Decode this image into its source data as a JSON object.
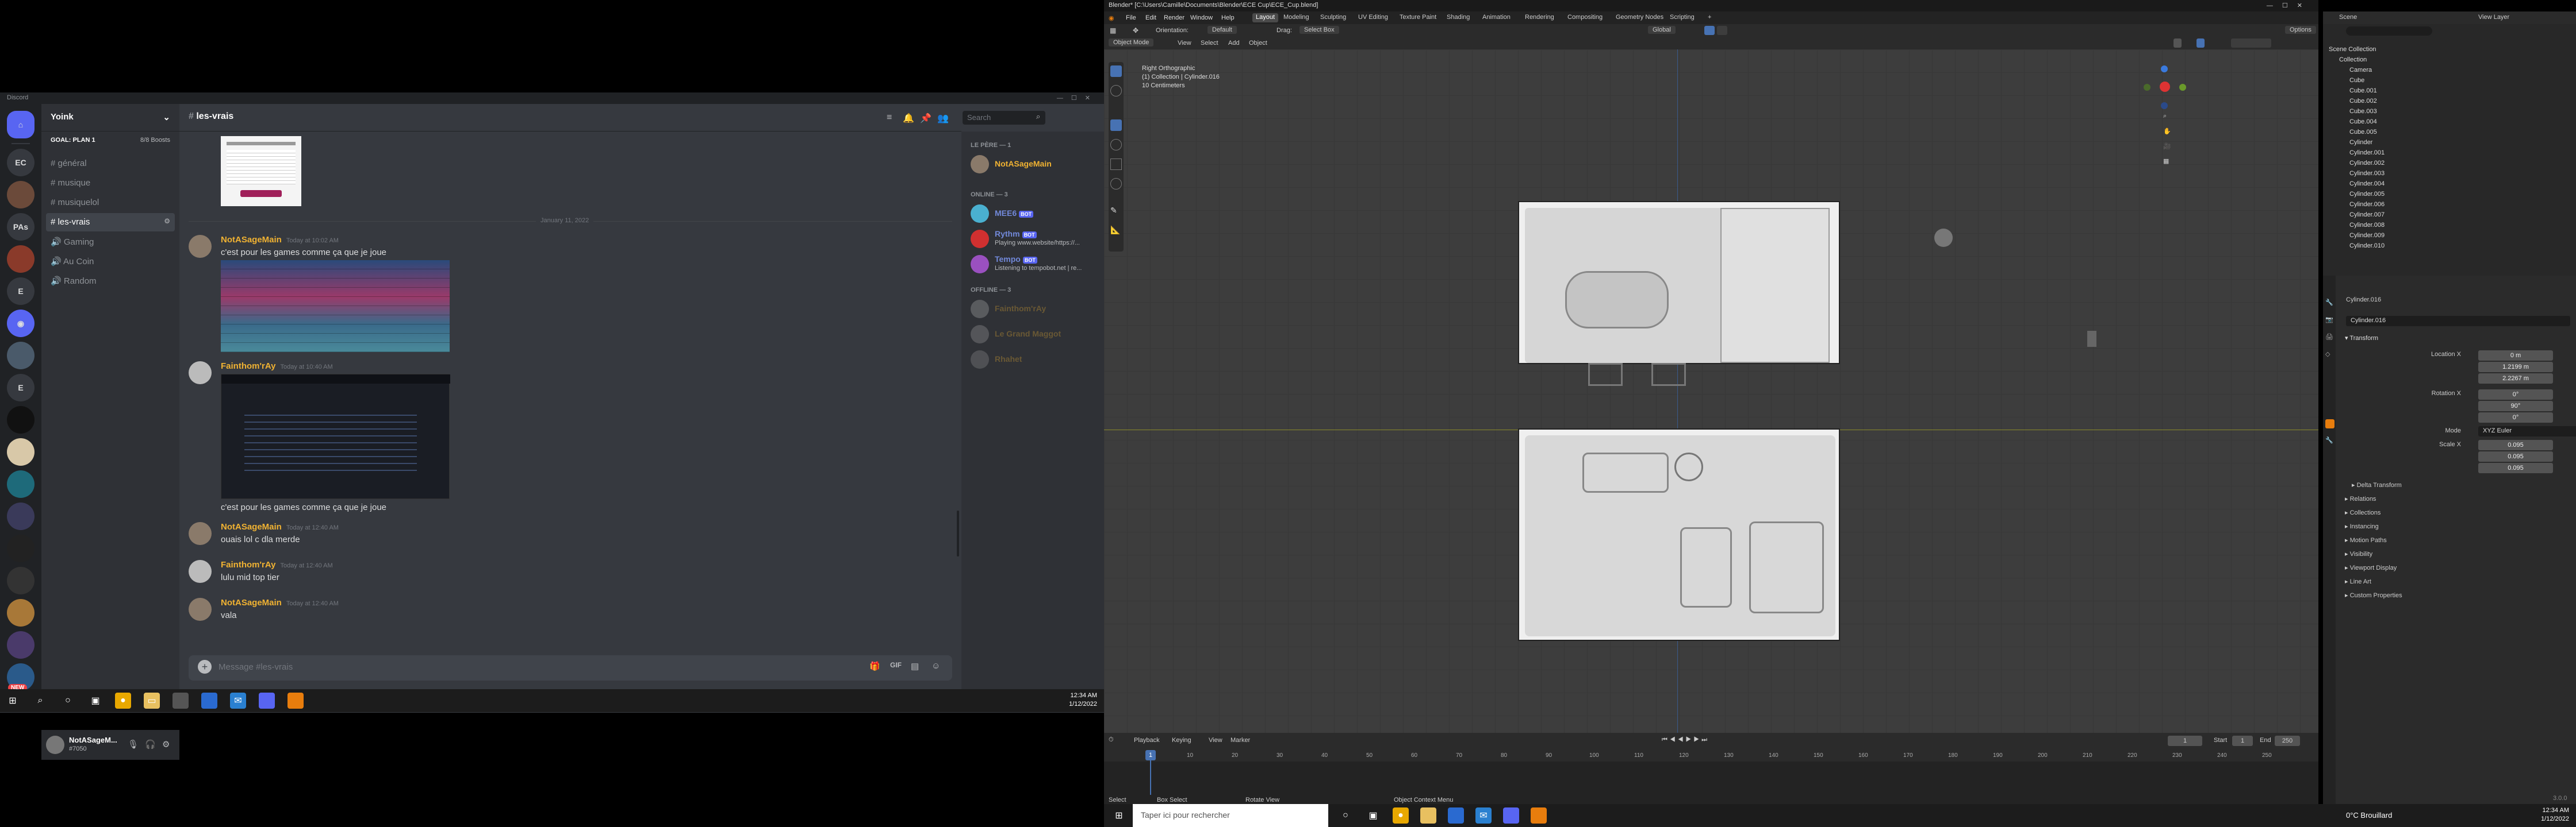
{
  "discord": {
    "window_title": "Discord",
    "server_name": "Yoink",
    "boost": {
      "goal": "GOAL: PLAN 1",
      "count": "8/8 Boosts"
    },
    "channels": [
      "général",
      "musique",
      "musiquelol",
      "les-vrais",
      "Gaming",
      "Au Coin",
      "Random"
    ],
    "current_channel": "les-vrais",
    "guild_labels": [
      "EC",
      "PAs",
      "E",
      "E"
    ],
    "search_placeholder": "Search",
    "date_divider": "January 11, 2022",
    "messages": [
      {
        "author": "NotASageMain",
        "time": "Today at 10:02 AM",
        "text": "c'est pour les games comme ça que je joue",
        "color": "#f0b232"
      },
      {
        "author": "Fainthom'rAy",
        "time": "Today at 10:40 AM",
        "text": "c'est pour les games comme ça que je joue",
        "color": "#f0b232"
      },
      {
        "author": "NotASageMain",
        "time": "Today at 12:40 AM",
        "text": "ouais lol c dla merde",
        "color": "#f0b232"
      },
      {
        "author": "Fainthom'rAy",
        "time": "Today at 12:40 AM",
        "text": "lulu mid top tier",
        "color": "#f0b232"
      },
      {
        "author": "NotASageMain",
        "time": "Today at 12:40 AM",
        "text": "vala",
        "color": "#f0b232"
      }
    ],
    "composer_placeholder": "Message #les-vrais",
    "members": {
      "le_pere_header": "LE PÈRE — 1",
      "le_pere": [
        {
          "name": "NotASageMain",
          "status": "",
          "color": "#f0b232"
        }
      ],
      "online_header": "ONLINE — 3",
      "online": [
        {
          "name": "MEE6",
          "status": "",
          "color": "#7289da",
          "bot": "BOT"
        },
        {
          "name": "Rythm",
          "status": "Playing www.website/https://...",
          "color": "#7289da",
          "bot": "BOT"
        },
        {
          "name": "Tempo",
          "status": "Listening to tempobot.net | re...",
          "color": "#7289da",
          "bot": "BOT"
        }
      ],
      "offline_header": "OFFLINE — 3",
      "offline": [
        {
          "name": "Fainthom'rAy"
        },
        {
          "name": "Le Grand Maggot"
        },
        {
          "name": "Rhahet"
        }
      ]
    },
    "user": {
      "name": "NotASageM...",
      "tag": "#7050"
    },
    "new_badge": "NEW"
  },
  "taskbar_left": {
    "time": "12:34 AM",
    "date": "1/12/2022"
  },
  "blender": {
    "title": "Blender* [C:\\Users\\Camille\\Documents\\Blender\\ECE Cup\\ECE_Cup.blend]",
    "menus": [
      "File",
      "Edit",
      "Render",
      "Window",
      "Help"
    ],
    "workspaces": [
      "Layout",
      "Modeling",
      "Sculpting",
      "UV Editing",
      "Texture Paint",
      "Shading",
      "Animation",
      "Rendering",
      "Compositing",
      "Geometry Nodes",
      "Scripting"
    ],
    "active_workspace": "Layout",
    "toolbar": {
      "orientation_label": "Orientation:",
      "orientation": "Default",
      "drag_label": "Drag:",
      "drag": "Select Box",
      "transform": "Global",
      "options": "Options"
    },
    "header": {
      "mode": "Object Mode",
      "menus": [
        "View",
        "Select",
        "Add",
        "Object"
      ]
    },
    "overlay_text": [
      "Right Orthographic",
      "(1) Collection | Cylinder.016",
      "10 Centimeters"
    ],
    "timeline": {
      "menus": [
        "Playback",
        "Keying",
        "View",
        "Marker"
      ],
      "current": "1",
      "start_label": "Start",
      "start": "1",
      "end_label": "End",
      "end": "250",
      "ticks": [
        "10",
        "20",
        "30",
        "40",
        "50",
        "60",
        "70",
        "80",
        "90",
        "100",
        "110",
        "120",
        "130",
        "140",
        "150",
        "160",
        "170",
        "180",
        "190",
        "200",
        "210",
        "220",
        "230",
        "240",
        "250"
      ]
    },
    "status": [
      "Select",
      "Box Select",
      "Rotate View",
      "Object Context Menu"
    ],
    "version": "3.0.0",
    "scene": "Scene",
    "view_layer": "View Layer",
    "outliner": {
      "root": "Scene Collection",
      "collection": "Collection",
      "items": [
        "Camera",
        "Cube",
        "Cube.001",
        "Cube.002",
        "Cube.003",
        "Cube.004",
        "Cube.005",
        "Cylinder",
        "Cylinder.001",
        "Cylinder.002",
        "Cylinder.003",
        "Cylinder.004",
        "Cylinder.005",
        "Cylinder.006",
        "Cylinder.007",
        "Cylinder.008",
        "Cylinder.009",
        "Cylinder.010"
      ]
    },
    "properties": {
      "object": "Cylinder.016",
      "object_field": "Cylinder.016",
      "transform": "Transform",
      "location_label": "Location X",
      "location": [
        "0 m",
        "1.2199 m",
        "2.2267 m"
      ],
      "rotation_label": "Rotation X",
      "rotation": [
        "0°",
        "90°",
        "0°"
      ],
      "mode_label": "Mode",
      "mode": "XYZ Euler",
      "scale_label": "Scale X",
      "scale": [
        "0.095",
        "0.095",
        "0.095"
      ],
      "sections": [
        "Delta Transform",
        "Relations",
        "Collections",
        "Instancing",
        "Motion Paths",
        "Visibility",
        "Viewport Display",
        "Line Art",
        "Custom Properties"
      ]
    }
  },
  "taskbar_right": {
    "search_placeholder": "Taper ici pour rechercher",
    "weather": "0°C  Brouillard",
    "time": "12:34 AM",
    "date": "1/12/2022"
  }
}
